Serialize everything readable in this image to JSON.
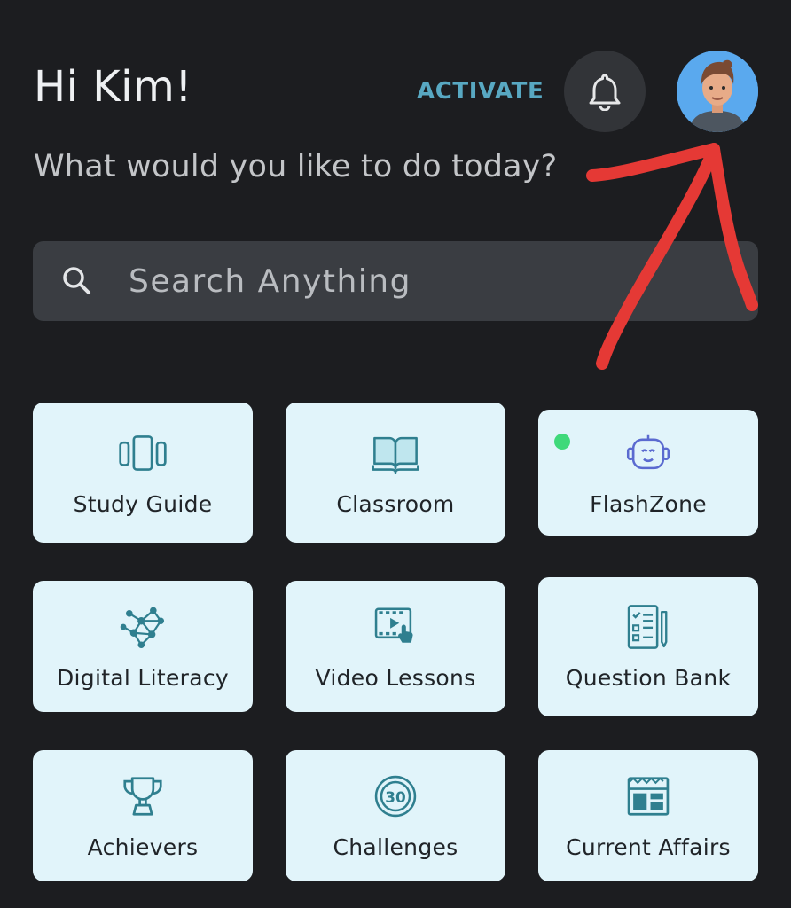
{
  "header": {
    "greeting": "Hi Kim!",
    "activate_label": "ACTIVATE",
    "subtitle": "What would you like to do today?"
  },
  "search": {
    "placeholder": "Search Anything"
  },
  "tiles": [
    {
      "label": "Study Guide",
      "icon": "study-guide-icon"
    },
    {
      "label": "Classroom",
      "icon": "book-icon"
    },
    {
      "label": "FlashZone",
      "icon": "robot-icon"
    },
    {
      "label": "Digital Literacy",
      "icon": "network-icon"
    },
    {
      "label": "Video Lessons",
      "icon": "video-icon"
    },
    {
      "label": "Question Bank",
      "icon": "checklist-icon"
    },
    {
      "label": "Achievers",
      "icon": "trophy-icon"
    },
    {
      "label": "Challenges",
      "icon": "timer-30-icon"
    },
    {
      "label": "Current Affairs",
      "icon": "newspaper-icon"
    }
  ],
  "colors": {
    "background": "#1c1d20",
    "accent": "#58a8c2",
    "tile_bg": "#e1f4fa",
    "icon": "#2f7f8f",
    "annotation": "#e53935",
    "status_dot": "#3fd97a"
  }
}
